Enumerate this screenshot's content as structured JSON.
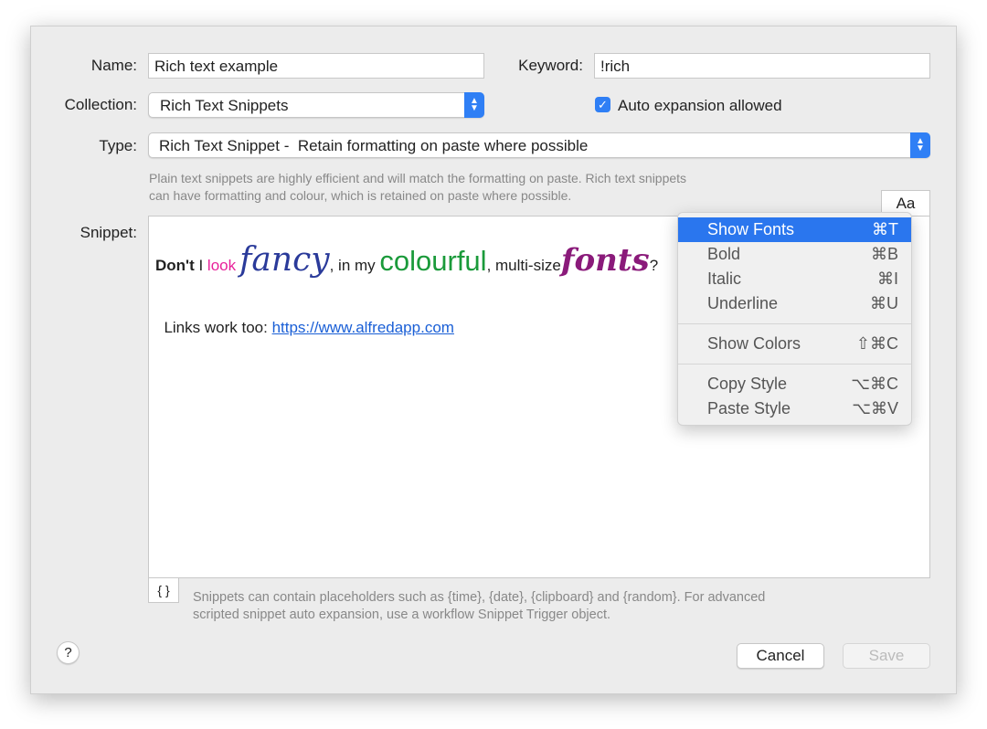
{
  "form": {
    "name_label": "Name:",
    "name_value": "Rich text example",
    "keyword_label": "Keyword:",
    "keyword_value": "!rich",
    "collection_label": "Collection:",
    "collection_value": "Rich Text Snippets",
    "auto_expansion_label": "Auto expansion allowed",
    "auto_expansion_checked": true,
    "type_label": "Type:",
    "type_value": "Rich Text Snippet -  Retain formatting on paste where possible",
    "type_help_1": "Plain text snippets are highly efficient and will match the formatting on paste. Rich text snippets",
    "type_help_2": "can have formatting and colour, which is retained on paste where possible.",
    "snippet_label": "Snippet:",
    "font_button": "Aa",
    "placeholder_button": "{ }",
    "placeholder_help_1": "Snippets can contain placeholders such as {time}, {date}, {clipboard} and {random}. For advanced",
    "placeholder_help_2": "scripted snippet auto expansion, use a workflow Snippet Trigger object."
  },
  "snippet": {
    "w1": "Don't",
    "w2": " I ",
    "w3": "look",
    "w4": "fancy",
    "w5": ", in my ",
    "w6": "colourful",
    "w7": ", multi-size",
    "w8": "fonts",
    "w9": "?",
    "line2": "Links work too: ",
    "link": "https://www.alfredapp.com",
    "colors": {
      "pink": "#e8209a",
      "blue": "#2a3a9a",
      "green": "#1a9a3a",
      "purple": "#8a1a7a",
      "link": "#1a5fd6"
    }
  },
  "menu": {
    "items": [
      {
        "label": "Show Fonts",
        "shortcut": "⌘T"
      },
      {
        "label": "Bold",
        "shortcut": "⌘B"
      },
      {
        "label": "Italic",
        "shortcut": "⌘I"
      },
      {
        "label": "Underline",
        "shortcut": "⌘U"
      },
      {
        "label": "Show Colors",
        "shortcut": "⇧⌘C"
      },
      {
        "label": "Copy Style",
        "shortcut": "⌥⌘C"
      },
      {
        "label": "Paste Style",
        "shortcut": "⌥⌘V"
      }
    ]
  },
  "footer": {
    "help": "?",
    "cancel": "Cancel",
    "save": "Save"
  }
}
